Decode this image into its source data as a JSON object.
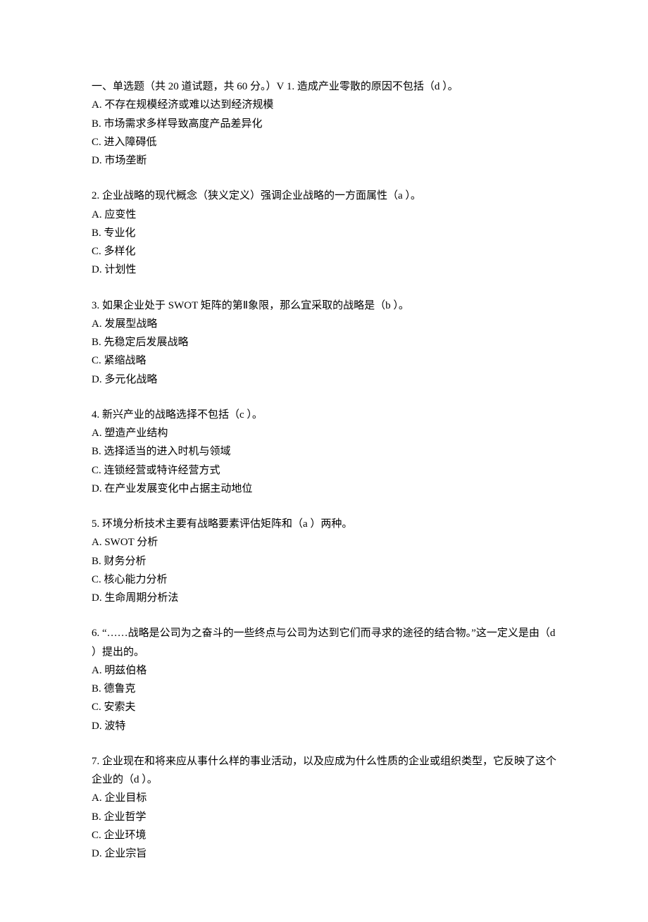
{
  "section_header": "一、单选题（共 20 道试题，共 60 分。）V 1.   造成产业零散的原因不包括（d ）。",
  "questions": [
    {
      "number": "1",
      "text": "造成产业零散的原因不包括（d ）。",
      "options": [
        "A.  不存在规模经济或难以达到经济规模",
        "B.  市场需求多样导致高度产品差异化",
        "C.  进入障碍低",
        "D.  市场垄断"
      ]
    },
    {
      "number": "2",
      "text": "2.   企业战略的现代概念（狭义定义）强调企业战略的一方面属性（a ）。",
      "options": [
        "A.  应变性",
        "B.  专业化",
        "C.  多样化",
        "D.  计划性"
      ]
    },
    {
      "number": "3",
      "text": "3.   如果企业处于 SWOT 矩阵的第Ⅱ象限，那么宜采取的战略是（b ）。",
      "options": [
        "A.  发展型战略",
        "B.  先稳定后发展战略",
        "C.  紧缩战略",
        "D.  多元化战略"
      ]
    },
    {
      "number": "4",
      "text": "4.   新兴产业的战略选择不包括（c ）。",
      "options": [
        "A.  塑造产业结构",
        "B.  选择适当的进入时机与领域",
        "C.  连锁经营或特许经营方式",
        "D.  在产业发展变化中占据主动地位"
      ]
    },
    {
      "number": "5",
      "text": "5.   环境分析技术主要有战略要素评估矩阵和（a ）两种。",
      "options": [
        "A. SWOT 分析",
        "B.  财务分析",
        "C.  核心能力分析",
        "D.  生命周期分析法"
      ]
    },
    {
      "number": "6",
      "text": "6.   “……战略是公司为之奋斗的一些终点与公司为达到它们而寻求的途径的结合物。”这一定义是由（d ）提出的。",
      "options": [
        "A.  明兹伯格",
        "B.  德鲁克",
        "C.  安索夫",
        "D.  波特"
      ]
    },
    {
      "number": "7",
      "text": "7.   企业现在和将来应从事什么样的事业活动，以及应成为什么性质的企业或组织类型，它反映了这个企业的（d ）。",
      "options": [
        "A.  企业目标",
        "B.  企业哲学",
        "C.  企业环境",
        "D.  企业宗旨"
      ]
    }
  ]
}
